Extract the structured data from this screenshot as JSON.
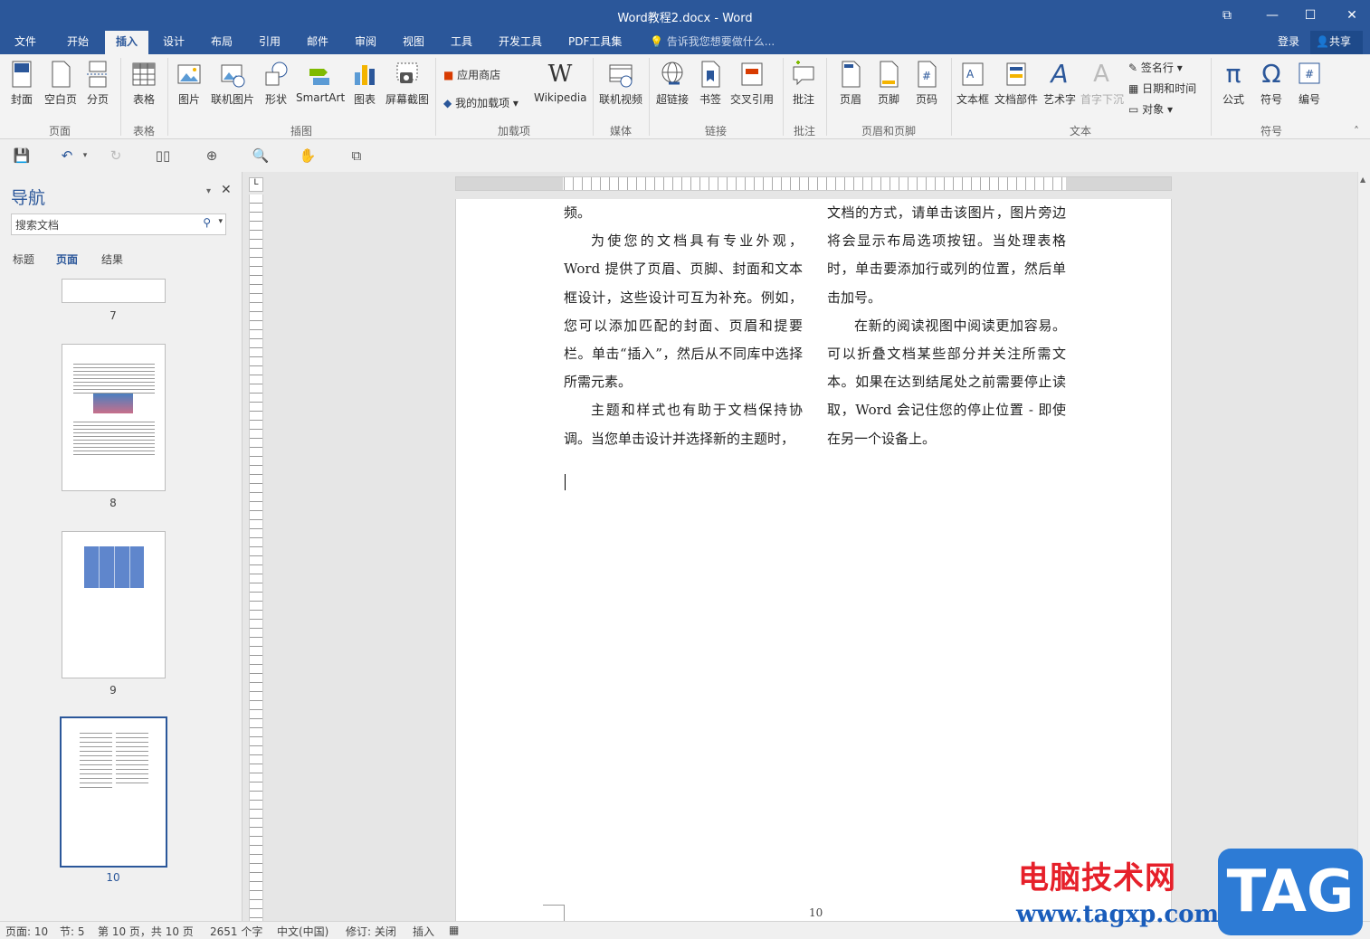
{
  "window": {
    "title": "Word教程2.docx - Word"
  },
  "menu": {
    "tabs": [
      "文件",
      "开始",
      "插入",
      "设计",
      "布局",
      "引用",
      "邮件",
      "审阅",
      "视图",
      "工具",
      "开发工具",
      "PDF工具集"
    ],
    "active": "插入",
    "tellme": "告诉我您想要做什么...",
    "login": "登录",
    "share": "共享"
  },
  "ribbon": {
    "pages": {
      "cover": "封面",
      "blank": "空白页",
      "break": "分页",
      "group": "页面"
    },
    "tables": {
      "table": "表格",
      "group": "表格"
    },
    "illustrations": {
      "picture": "图片",
      "online_picture": "联机图片",
      "shapes": "形状",
      "smartart": "SmartArt",
      "chart": "图表",
      "screenshot": "屏幕截图",
      "group": "插图"
    },
    "addins": {
      "store": "应用商店",
      "my_addins": "我的加载项",
      "wikipedia": "Wikipedia",
      "group": "加载项"
    },
    "media": {
      "online_video": "联机视频",
      "group": "媒体"
    },
    "links": {
      "hyperlink": "超链接",
      "bookmark": "书签",
      "crossref": "交叉引用",
      "group": "链接"
    },
    "comments": {
      "comment": "批注",
      "group": "批注"
    },
    "header_footer": {
      "header": "页眉",
      "footer": "页脚",
      "page_number": "页码",
      "group": "页眉和页脚"
    },
    "text": {
      "textbox": "文本框",
      "quickparts": "文档部件",
      "wordart": "艺术字",
      "dropcap": "首字下沉",
      "signature": "签名行",
      "datetime": "日期和时间",
      "object": "对象",
      "group": "文本"
    },
    "symbols": {
      "equation": "公式",
      "symbol": "符号",
      "number": "编号",
      "group": "符号"
    }
  },
  "nav": {
    "title": "导航",
    "search_placeholder": "搜索文档",
    "tabs": [
      "标题",
      "页面",
      "结果"
    ],
    "active_tab": "页面",
    "pages": [
      "7",
      "8",
      "9",
      "10"
    ],
    "selected_page": "10"
  },
  "document": {
    "left_col": [
      {
        "text": "频。",
        "indent": false
      },
      {
        "text": "为使您的文档具有专业外观，Word 提供了页眉、页脚、封面和文本框设计，这些设计可互为补充。例如，您可以添加匹配的封面、页眉和提要栏。单击“插入”，然后从不同库中选择所需元素。",
        "indent": true
      },
      {
        "text": "主题和样式也有助于文档保持协调。当您单击设计并选择新的主题时，",
        "indent": true
      }
    ],
    "right_col": [
      {
        "text": "文档的方式，请单击该图片，图片旁边将会显示布局选项按钮。当处理表格时，单击要添加行或列的位置，然后单击加号。",
        "indent": false
      },
      {
        "text": "在新的阅读视图中阅读更加容易。可以折叠文档某些部分并关注所需文本。如果在达到结尾处之前需要停止读取，Word 会记住您的停止位置 - 即使在另一个设备上。",
        "indent": true
      }
    ],
    "footer_page_number": "10"
  },
  "status": {
    "page": "页面: 10",
    "section": "节: 5",
    "pages": "第 10 页，共 10 页",
    "words": "2651 个字",
    "lang": "中文(中国)",
    "track": "修订: 关闭",
    "mode": "插入"
  },
  "watermark": {
    "site_name": "电脑技术网",
    "url": "www.tagxp.com",
    "tag": "TAG"
  },
  "colors": {
    "accent": "#2b579a",
    "page": "#ffffff",
    "ribbon": "#f3f3f3"
  }
}
